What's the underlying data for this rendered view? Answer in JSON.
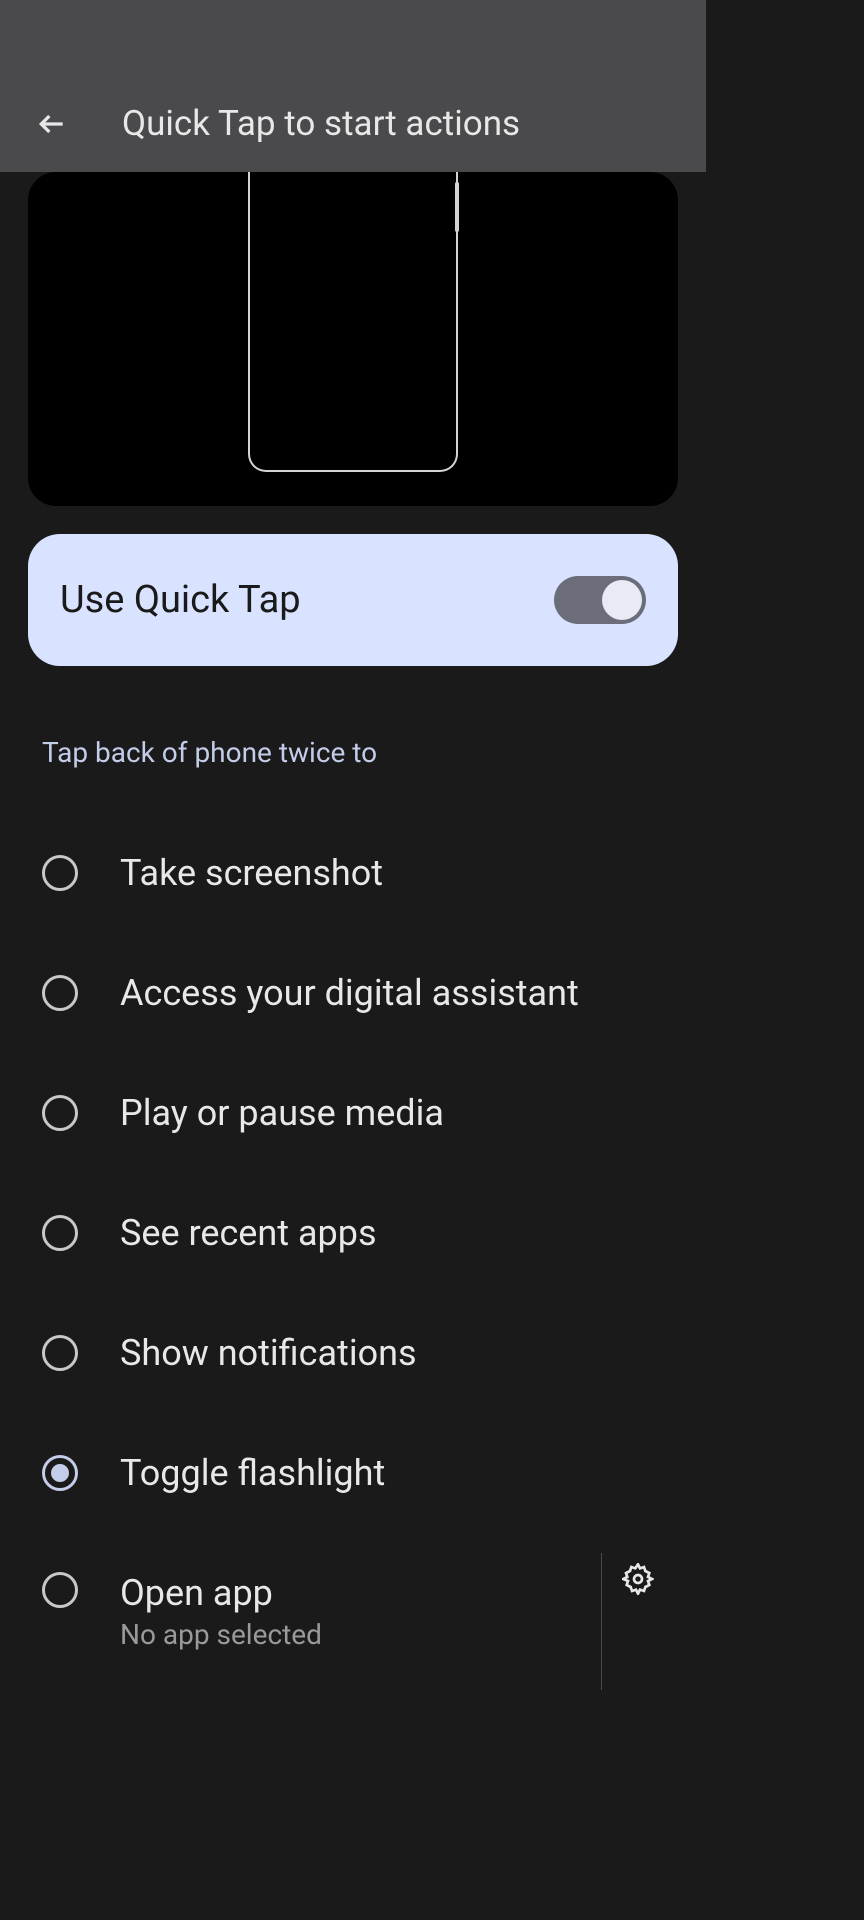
{
  "header": {
    "title": "Quick Tap to start actions"
  },
  "toggle": {
    "label": "Use Quick Tap",
    "enabled": true
  },
  "section": {
    "label": "Tap back of phone twice to"
  },
  "options": [
    {
      "label": "Take screenshot",
      "selected": false
    },
    {
      "label": "Access your digital assistant",
      "selected": false
    },
    {
      "label": "Play or pause media",
      "selected": false
    },
    {
      "label": "See recent apps",
      "selected": false
    },
    {
      "label": "Show notifications",
      "selected": false
    },
    {
      "label": "Toggle flashlight",
      "selected": true
    },
    {
      "label": "Open app",
      "sublabel": "No app selected",
      "selected": false,
      "hasSettings": true
    }
  ]
}
